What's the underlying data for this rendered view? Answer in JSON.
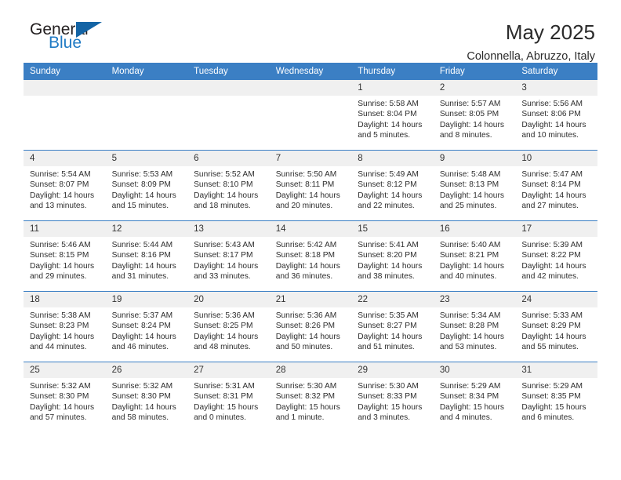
{
  "brand": {
    "name_part1": "General",
    "name_part2": "Blue",
    "triangle_color": "#1464a5",
    "blue_color": "#1f7ac4"
  },
  "header": {
    "title": "May 2025",
    "subtitle": "Colonnella, Abruzzo, Italy",
    "header_bg": "#3b7fc4",
    "header_text_color": "#ffffff"
  },
  "weekdays": [
    "Sunday",
    "Monday",
    "Tuesday",
    "Wednesday",
    "Thursday",
    "Friday",
    "Saturday"
  ],
  "labels": {
    "sunrise": "Sunrise:",
    "sunset": "Sunset:",
    "daylight": "Daylight:"
  },
  "weeks": [
    [
      {
        "day": "",
        "empty": true
      },
      {
        "day": "",
        "empty": true
      },
      {
        "day": "",
        "empty": true
      },
      {
        "day": "",
        "empty": true
      },
      {
        "day": "1",
        "sunrise": "Sunrise: 5:58 AM",
        "sunset": "Sunset: 8:04 PM",
        "daylight1": "Daylight: 14 hours",
        "daylight2": "and 5 minutes."
      },
      {
        "day": "2",
        "sunrise": "Sunrise: 5:57 AM",
        "sunset": "Sunset: 8:05 PM",
        "daylight1": "Daylight: 14 hours",
        "daylight2": "and 8 minutes."
      },
      {
        "day": "3",
        "sunrise": "Sunrise: 5:56 AM",
        "sunset": "Sunset: 8:06 PM",
        "daylight1": "Daylight: 14 hours",
        "daylight2": "and 10 minutes."
      }
    ],
    [
      {
        "day": "4",
        "sunrise": "Sunrise: 5:54 AM",
        "sunset": "Sunset: 8:07 PM",
        "daylight1": "Daylight: 14 hours",
        "daylight2": "and 13 minutes."
      },
      {
        "day": "5",
        "sunrise": "Sunrise: 5:53 AM",
        "sunset": "Sunset: 8:09 PM",
        "daylight1": "Daylight: 14 hours",
        "daylight2": "and 15 minutes."
      },
      {
        "day": "6",
        "sunrise": "Sunrise: 5:52 AM",
        "sunset": "Sunset: 8:10 PM",
        "daylight1": "Daylight: 14 hours",
        "daylight2": "and 18 minutes."
      },
      {
        "day": "7",
        "sunrise": "Sunrise: 5:50 AM",
        "sunset": "Sunset: 8:11 PM",
        "daylight1": "Daylight: 14 hours",
        "daylight2": "and 20 minutes."
      },
      {
        "day": "8",
        "sunrise": "Sunrise: 5:49 AM",
        "sunset": "Sunset: 8:12 PM",
        "daylight1": "Daylight: 14 hours",
        "daylight2": "and 22 minutes."
      },
      {
        "day": "9",
        "sunrise": "Sunrise: 5:48 AM",
        "sunset": "Sunset: 8:13 PM",
        "daylight1": "Daylight: 14 hours",
        "daylight2": "and 25 minutes."
      },
      {
        "day": "10",
        "sunrise": "Sunrise: 5:47 AM",
        "sunset": "Sunset: 8:14 PM",
        "daylight1": "Daylight: 14 hours",
        "daylight2": "and 27 minutes."
      }
    ],
    [
      {
        "day": "11",
        "sunrise": "Sunrise: 5:46 AM",
        "sunset": "Sunset: 8:15 PM",
        "daylight1": "Daylight: 14 hours",
        "daylight2": "and 29 minutes."
      },
      {
        "day": "12",
        "sunrise": "Sunrise: 5:44 AM",
        "sunset": "Sunset: 8:16 PM",
        "daylight1": "Daylight: 14 hours",
        "daylight2": "and 31 minutes."
      },
      {
        "day": "13",
        "sunrise": "Sunrise: 5:43 AM",
        "sunset": "Sunset: 8:17 PM",
        "daylight1": "Daylight: 14 hours",
        "daylight2": "and 33 minutes."
      },
      {
        "day": "14",
        "sunrise": "Sunrise: 5:42 AM",
        "sunset": "Sunset: 8:18 PM",
        "daylight1": "Daylight: 14 hours",
        "daylight2": "and 36 minutes."
      },
      {
        "day": "15",
        "sunrise": "Sunrise: 5:41 AM",
        "sunset": "Sunset: 8:20 PM",
        "daylight1": "Daylight: 14 hours",
        "daylight2": "and 38 minutes."
      },
      {
        "day": "16",
        "sunrise": "Sunrise: 5:40 AM",
        "sunset": "Sunset: 8:21 PM",
        "daylight1": "Daylight: 14 hours",
        "daylight2": "and 40 minutes."
      },
      {
        "day": "17",
        "sunrise": "Sunrise: 5:39 AM",
        "sunset": "Sunset: 8:22 PM",
        "daylight1": "Daylight: 14 hours",
        "daylight2": "and 42 minutes."
      }
    ],
    [
      {
        "day": "18",
        "sunrise": "Sunrise: 5:38 AM",
        "sunset": "Sunset: 8:23 PM",
        "daylight1": "Daylight: 14 hours",
        "daylight2": "and 44 minutes."
      },
      {
        "day": "19",
        "sunrise": "Sunrise: 5:37 AM",
        "sunset": "Sunset: 8:24 PM",
        "daylight1": "Daylight: 14 hours",
        "daylight2": "and 46 minutes."
      },
      {
        "day": "20",
        "sunrise": "Sunrise: 5:36 AM",
        "sunset": "Sunset: 8:25 PM",
        "daylight1": "Daylight: 14 hours",
        "daylight2": "and 48 minutes."
      },
      {
        "day": "21",
        "sunrise": "Sunrise: 5:36 AM",
        "sunset": "Sunset: 8:26 PM",
        "daylight1": "Daylight: 14 hours",
        "daylight2": "and 50 minutes."
      },
      {
        "day": "22",
        "sunrise": "Sunrise: 5:35 AM",
        "sunset": "Sunset: 8:27 PM",
        "daylight1": "Daylight: 14 hours",
        "daylight2": "and 51 minutes."
      },
      {
        "day": "23",
        "sunrise": "Sunrise: 5:34 AM",
        "sunset": "Sunset: 8:28 PM",
        "daylight1": "Daylight: 14 hours",
        "daylight2": "and 53 minutes."
      },
      {
        "day": "24",
        "sunrise": "Sunrise: 5:33 AM",
        "sunset": "Sunset: 8:29 PM",
        "daylight1": "Daylight: 14 hours",
        "daylight2": "and 55 minutes."
      }
    ],
    [
      {
        "day": "25",
        "sunrise": "Sunrise: 5:32 AM",
        "sunset": "Sunset: 8:30 PM",
        "daylight1": "Daylight: 14 hours",
        "daylight2": "and 57 minutes."
      },
      {
        "day": "26",
        "sunrise": "Sunrise: 5:32 AM",
        "sunset": "Sunset: 8:30 PM",
        "daylight1": "Daylight: 14 hours",
        "daylight2": "and 58 minutes."
      },
      {
        "day": "27",
        "sunrise": "Sunrise: 5:31 AM",
        "sunset": "Sunset: 8:31 PM",
        "daylight1": "Daylight: 15 hours",
        "daylight2": "and 0 minutes."
      },
      {
        "day": "28",
        "sunrise": "Sunrise: 5:30 AM",
        "sunset": "Sunset: 8:32 PM",
        "daylight1": "Daylight: 15 hours",
        "daylight2": "and 1 minute."
      },
      {
        "day": "29",
        "sunrise": "Sunrise: 5:30 AM",
        "sunset": "Sunset: 8:33 PM",
        "daylight1": "Daylight: 15 hours",
        "daylight2": "and 3 minutes."
      },
      {
        "day": "30",
        "sunrise": "Sunrise: 5:29 AM",
        "sunset": "Sunset: 8:34 PM",
        "daylight1": "Daylight: 15 hours",
        "daylight2": "and 4 minutes."
      },
      {
        "day": "31",
        "sunrise": "Sunrise: 5:29 AM",
        "sunset": "Sunset: 8:35 PM",
        "daylight1": "Daylight: 15 hours",
        "daylight2": "and 6 minutes."
      }
    ]
  ]
}
